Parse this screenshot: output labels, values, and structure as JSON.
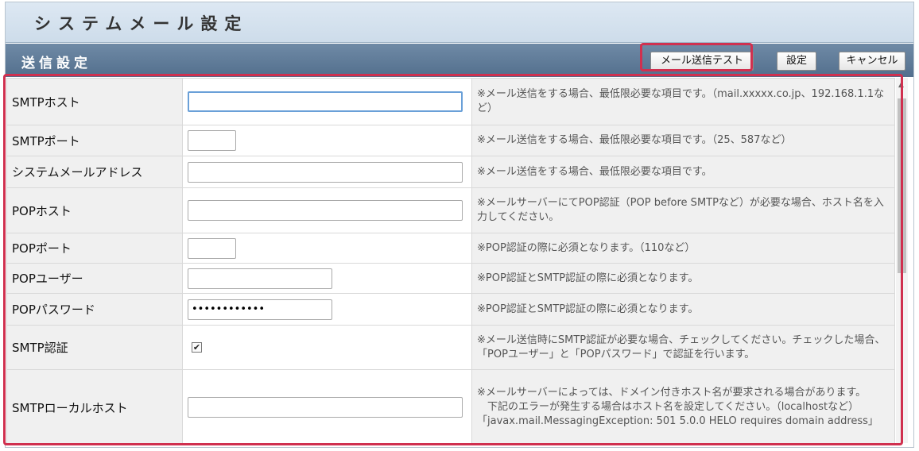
{
  "header": {
    "title": "システムメール設定"
  },
  "section": {
    "title": "送信設定",
    "buttons": {
      "test": "メール送信テスト",
      "set": "設定",
      "cancel": "キャンセル"
    }
  },
  "rows": [
    {
      "label": "SMTPホスト",
      "value": "",
      "note": "※メール送信をする場合、最低限必要な項目です。（mail.xxxxx.co.jp、192.168.1.1など）"
    },
    {
      "label": "SMTPポート",
      "value": "",
      "note": "※メール送信をする場合、最低限必要な項目です。（25、587など）"
    },
    {
      "label": "システムメールアドレス",
      "value": "",
      "note": "※メール送信をする場合、最低限必要な項目です。"
    },
    {
      "label": "POPホスト",
      "value": "",
      "note": "※メールサーバーにてPOP認証（POP before SMTPなど）が必要な場合、ホスト名を入力してください。"
    },
    {
      "label": "POPポート",
      "value": "",
      "note": "※POP認証の際に必須となります。（110など）"
    },
    {
      "label": "POPユーザー",
      "value": "",
      "note": "※POP認証とSMTP認証の際に必須となります。"
    },
    {
      "label": "POPパスワード",
      "value": "••••••••••••",
      "note": "※POP認証とSMTP認証の際に必須となります。"
    },
    {
      "label": "SMTP認証",
      "checked": "✔",
      "note": "※メール送信時にSMTP認証が必要な場合、チェックしてください。チェックした場合、「POPユーザー」と「POPパスワード」で認証を行います。"
    },
    {
      "label": "SMTPローカルホスト",
      "value": "",
      "note_lines": [
        "※メールサーバーによっては、ドメイン付きホスト名が要求される場合があります。",
        "　下記のエラーが発生する場合はホスト名を設定してください。（localhostなど）",
        "「javax.mail.MessagingException: 501 5.0.0 HELO requires domain address」"
      ]
    }
  ],
  "scrollbar": {
    "up_icon": "▲"
  }
}
